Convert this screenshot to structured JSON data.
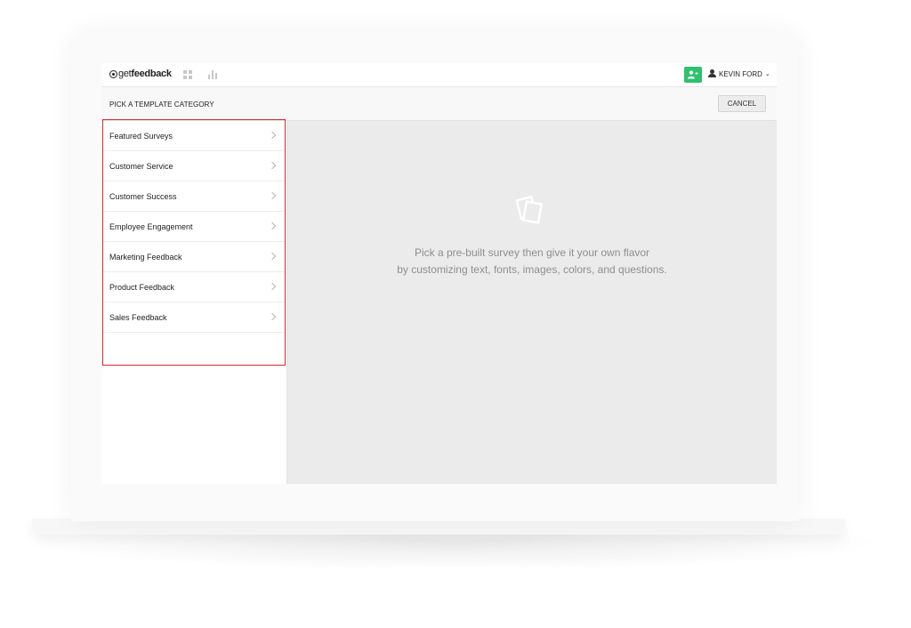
{
  "header": {
    "logo_prefix": "get",
    "logo_bold": "feedback",
    "user_name": "KEVIN FORD",
    "caret": "⌄"
  },
  "subheader": {
    "title": "PICK A TEMPLATE CATEGORY",
    "cancel_label": "CANCEL"
  },
  "categories": [
    {
      "label": "Featured Surveys"
    },
    {
      "label": "Customer Service"
    },
    {
      "label": "Customer Success"
    },
    {
      "label": "Employee Engagement"
    },
    {
      "label": "Marketing Feedback"
    },
    {
      "label": "Product Feedback"
    },
    {
      "label": "Sales Feedback"
    }
  ],
  "empty_state": {
    "line1": "Pick a pre-built survey then give it your own flavor",
    "line2": "by customizing text, fonts, images, colors, and questions."
  },
  "colors": {
    "accent_green": "#2dc26b",
    "highlight_red": "#d9262c"
  },
  "icons": {
    "logo": "getfeedback-logo",
    "dashboard": "grid-icon",
    "reports": "bar-chart-icon",
    "add_user": "add-user-icon",
    "user": "user-icon",
    "chevron": "chevron-right-icon",
    "empty_state": "template-cards-icon"
  }
}
